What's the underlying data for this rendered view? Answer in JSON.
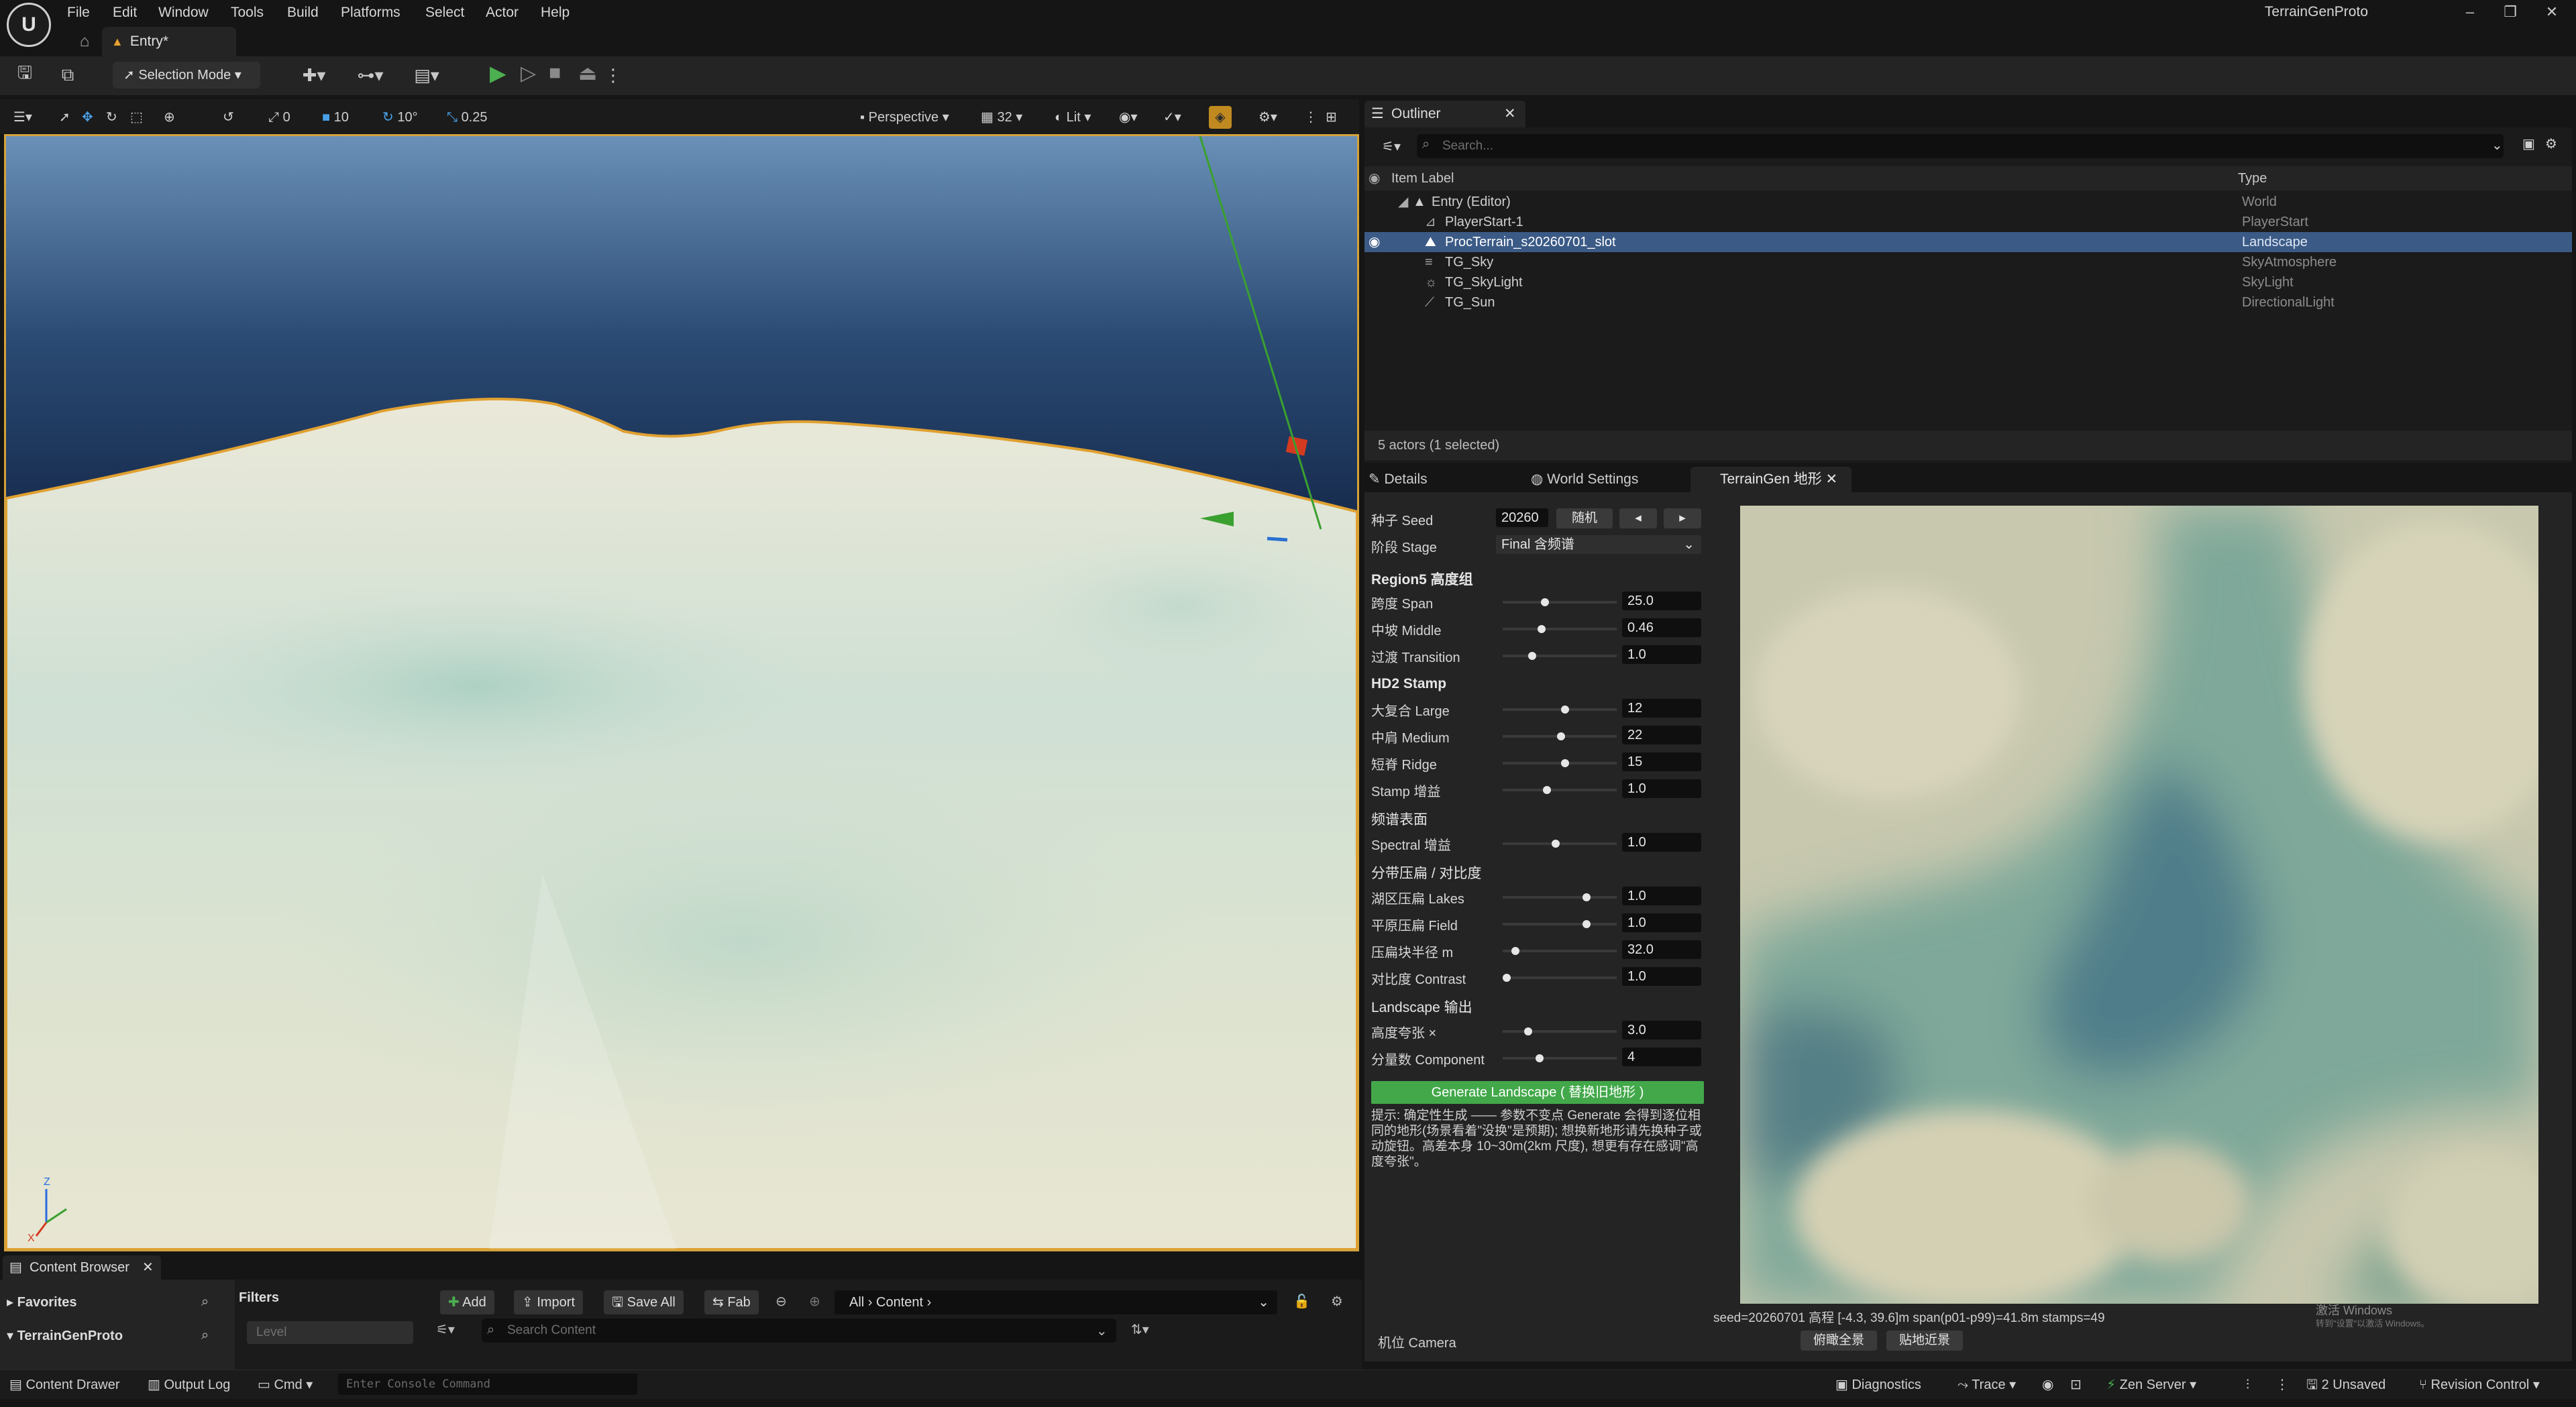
{
  "menu": [
    "File",
    "Edit",
    "Window",
    "Tools",
    "Build",
    "Platforms",
    "Select",
    "Actor",
    "Help"
  ],
  "app_name": "TerrainGenProto",
  "tab": {
    "label": "Entry*"
  },
  "toolbar": {
    "selection_mode": "Selection Mode"
  },
  "viewport_toolbar": {
    "rotate_snap": "0",
    "translate_snap": "10",
    "angle_snap": "10°",
    "scale_snap": "0.25",
    "perspective": "Perspective",
    "camera_speed": "32",
    "view_mode": "Lit"
  },
  "outliner": {
    "tab_label": "Outliner",
    "search_placeholder": "Search...",
    "col_label": "Item Label",
    "col_type": "Type",
    "rows": [
      {
        "label": "Entry (Editor)",
        "type": "World"
      },
      {
        "label": "PlayerStart-1",
        "type": "PlayerStart"
      },
      {
        "label": "ProcTerrain_s20260701_slot",
        "type": "Landscape"
      },
      {
        "label": "TG_Sky",
        "type": "SkyAtmosphere"
      },
      {
        "label": "TG_SkyLight",
        "type": "SkyLight"
      },
      {
        "label": "TG_Sun",
        "type": "DirectionalLight"
      }
    ],
    "status": "5 actors (1 selected)"
  },
  "details_tabs": {
    "details": "Details",
    "world_settings": "World Settings",
    "terraingen": "TerrainGen 地形"
  },
  "terraingen": {
    "seed_label": "种子 Seed",
    "seed_value": "20260",
    "random_btn": "随机",
    "prev_btn": "◂",
    "next_btn": "▸",
    "stage_label": "阶段 Stage",
    "stage_value": "Final 含频谱",
    "sections": {
      "region5": "Region5 高度组",
      "hd2": "HD2 Stamp",
      "spectral": "频谱表面",
      "zone": "分带压扁 / 对比度",
      "landscape": "Landscape 输出"
    },
    "params": {
      "span": {
        "label": "跨度 Span",
        "value": "25.0",
        "slider": 0.36
      },
      "middle": {
        "label": "中坡 Middle",
        "value": "0.46",
        "slider": 0.33
      },
      "transition": {
        "label": "过渡 Transition",
        "value": "1.0",
        "slider": 0.24
      },
      "large": {
        "label": "大复合 Large",
        "value": "12",
        "slider": 0.55
      },
      "medium": {
        "label": "中肩 Medium",
        "value": "22",
        "slider": 0.51
      },
      "ridge": {
        "label": "短脊 Ridge",
        "value": "15",
        "slider": 0.55
      },
      "stamp_gain": {
        "label": "Stamp 增益",
        "value": "1.0",
        "slider": 0.38
      },
      "spectral_gain": {
        "label": "Spectral 增益",
        "value": "1.0",
        "slider": 0.46
      },
      "lakes": {
        "label": "湖区压扁 Lakes",
        "value": "1.0",
        "slider": 0.75
      },
      "field": {
        "label": "平原压扁 Field",
        "value": "1.0",
        "slider": 0.75
      },
      "radius": {
        "label": "压扁块半径 m",
        "value": "32.0",
        "slider": 0.08
      },
      "contrast": {
        "label": "对比度 Contrast",
        "value": "1.0",
        "slider": 0.0
      },
      "height_exag": {
        "label": "高度夸张 ×",
        "value": "3.0",
        "slider": 0.2
      },
      "component": {
        "label": "分量数 Component",
        "value": "4",
        "slider": 0.31
      }
    },
    "generate_btn": "Generate Landscape ( 替换旧地形 )",
    "hint": "提示: 确定性生成 —— 参数不变点 Generate 会得到逐位相同的地形(场景看着\"没换\"是预期); 想换新地形请先换种子或动旋钮。高差本身 10~30m(2km 尺度), 想更有存在感调\"高度夸张\"。",
    "stats": "seed=20260701  高程 [-4.3, 39.6]m  span(p01-p99)=41.8m  stamps=49",
    "camera_label": "机位 Camera",
    "cam_btn1": "俯瞰全景",
    "cam_btn2": "贴地近景"
  },
  "watermark": {
    "line1": "激活 Windows",
    "line2": "转到\"设置\"以激活 Windows。"
  },
  "content_browser": {
    "tab_label": "Content Browser",
    "favorites": "Favorites",
    "project": "TerrainGenProto",
    "filters": "Filters",
    "level_placeholder": "Level",
    "add_btn": "Add",
    "import_btn": "Import",
    "saveall_btn": "Save All",
    "fab_btn": "Fab",
    "path_all": "All",
    "path_content": "Content",
    "search_placeholder": "Search Content"
  },
  "statusbar": {
    "content_drawer": "Content Drawer",
    "output_log": "Output Log",
    "cmd": "Cmd",
    "console_placeholder": "Enter Console Command",
    "diagnostics": "Diagnostics",
    "trace": "Trace",
    "zen_server": "Zen Server",
    "unsaved": "2 Unsaved",
    "revision_control": "Revision Control"
  }
}
